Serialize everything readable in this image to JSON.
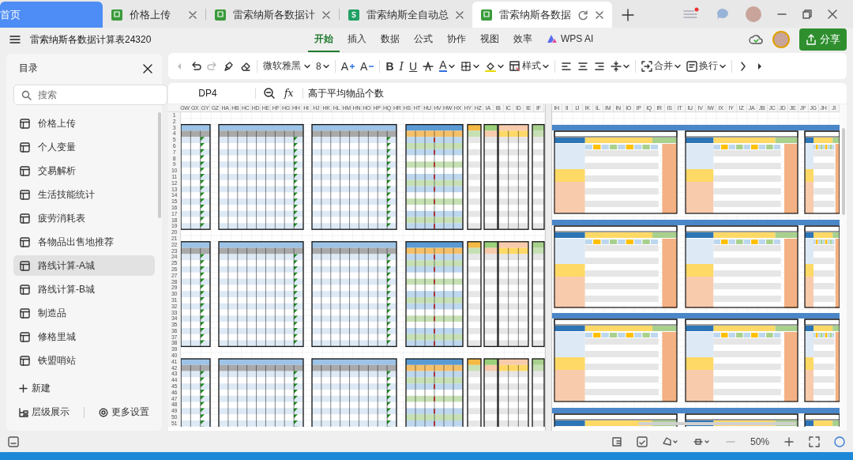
{
  "tabs": [
    {
      "kind": "home",
      "label": "首页",
      "selected": false
    },
    {
      "kind": "doc",
      "label": "价格上传",
      "selected": false
    },
    {
      "kind": "doc",
      "label": "雷索纳斯各数据计",
      "selected": false
    },
    {
      "kind": "sheet-s",
      "label": "雷索纳斯全自动总",
      "selected": false
    },
    {
      "kind": "doc",
      "label": "雷索纳斯各数据",
      "selected": true
    }
  ],
  "document_title": "雷索纳斯各数据计算表24320",
  "ribbon_tabs": [
    {
      "kind": "tab",
      "label": "开始",
      "selected": true
    },
    {
      "kind": "tab",
      "label": "插入",
      "selected": false
    },
    {
      "kind": "tab",
      "label": "数据",
      "selected": false
    },
    {
      "kind": "tab",
      "label": "公式",
      "selected": false
    },
    {
      "kind": "tab",
      "label": "协作",
      "selected": false
    },
    {
      "kind": "tab",
      "label": "视图",
      "selected": false
    },
    {
      "kind": "tab",
      "label": "效率",
      "selected": false
    },
    {
      "kind": "ai",
      "label": "WPS AI",
      "selected": false
    }
  ],
  "share_button": "分享",
  "sidebar": {
    "title": "目录",
    "search": {
      "placeholder": "搜索"
    },
    "items": [
      {
        "label": "价格上传",
        "selected": false
      },
      {
        "label": "个人变量",
        "selected": false
      },
      {
        "label": "交易解析",
        "selected": false
      },
      {
        "label": "生活技能统计",
        "selected": false
      },
      {
        "label": "疲劳消耗表",
        "selected": false
      },
      {
        "label": "各物品出售地推荐",
        "selected": false
      },
      {
        "label": "路线计算-A城",
        "selected": true
      },
      {
        "label": "路线计算-B城",
        "selected": false
      },
      {
        "label": "制造品",
        "selected": false
      },
      {
        "label": "修格里城",
        "selected": false
      },
      {
        "label": "铁盟哨站",
        "selected": false
      }
    ],
    "new_label": "新建",
    "footer": [
      "层级展示",
      "更多设置"
    ]
  },
  "toolbar": [
    {
      "kind": "scroll-left",
      "disabled": true
    },
    {
      "kind": "undo",
      "disabled": false
    },
    {
      "kind": "redo",
      "disabled": true
    },
    {
      "kind": "painter",
      "disabled": false
    },
    {
      "kind": "eraser",
      "disabled": false
    },
    {
      "kind": "font",
      "label": "微软雅黑",
      "disabled": false
    },
    {
      "kind": "size",
      "label": "8",
      "disabled": false
    },
    {
      "kind": "grow",
      "label": "A",
      "disabled": false
    },
    {
      "kind": "shrink",
      "label": "A",
      "disabled": false
    },
    {
      "kind": "bold",
      "label": "B",
      "disabled": false
    },
    {
      "kind": "italic",
      "label": "I",
      "disabled": false
    },
    {
      "kind": "underline",
      "label": "U",
      "disabled": false
    },
    {
      "kind": "strike",
      "disabled": false
    },
    {
      "kind": "font-color",
      "label": "A",
      "disabled": false
    },
    {
      "kind": "border",
      "disabled": false
    },
    {
      "kind": "fill",
      "disabled": false
    },
    {
      "kind": "style",
      "label": "样式",
      "disabled": false
    },
    {
      "kind": "align-left",
      "disabled": false
    },
    {
      "kind": "align-center",
      "disabled": false
    },
    {
      "kind": "align-right",
      "disabled": false
    },
    {
      "kind": "valign",
      "disabled": false
    },
    {
      "kind": "merge",
      "label": "合并",
      "disabled": false
    },
    {
      "kind": "wrap",
      "label": "换行",
      "disabled": false
    },
    {
      "kind": "more",
      "disabled": false
    },
    {
      "kind": "scroll-right",
      "disabled": false
    }
  ],
  "formula_bar": {
    "cell_ref": "DP4",
    "fx": "fx",
    "formula": "高于平均物品个数"
  },
  "sheet": {
    "left_columns": [
      "GW",
      "GX",
      "GY",
      "GZ",
      "HA",
      "HB",
      "HC",
      "HD",
      "HE",
      "HF",
      "HG",
      "HH",
      "HI",
      "HJ",
      "HK",
      "HL",
      "HM",
      "HN",
      "HO",
      "HP",
      "HQ",
      "HR",
      "HS",
      "HT",
      "HU",
      "HV",
      "HW",
      "HX",
      "HY",
      "HZ",
      "IA",
      "IB",
      "IC",
      "ID",
      "IE",
      "IF"
    ],
    "right_columns": [
      "IH",
      "II",
      "IJ",
      "IK",
      "IL",
      "IM",
      "IN",
      "IO",
      "IP",
      "IQ",
      "IR",
      "IS",
      "IT",
      "IU",
      "IV",
      "IW",
      "IX",
      "IY",
      "IZ",
      "JA",
      "JB",
      "JC",
      "JD",
      "JE",
      "JF",
      "JG",
      "JH",
      "JI"
    ],
    "rows": [
      "1",
      "2",
      "3",
      "4",
      "5",
      "6",
      "7",
      "8",
      "9",
      "10",
      "11",
      "12",
      "13",
      "14",
      "15",
      "16",
      "17",
      "18",
      "19",
      "20",
      "21",
      "22",
      "23",
      "24",
      "25",
      "26",
      "27",
      "28",
      "29",
      "30",
      "31",
      "32",
      "33",
      "34",
      "35",
      "36",
      "37",
      "38",
      "39",
      "40",
      "41",
      "42",
      "43",
      "44",
      "45",
      "46",
      "47",
      "48",
      "49",
      "50",
      "51"
    ]
  },
  "status_bar": {
    "zoom": "50%"
  }
}
